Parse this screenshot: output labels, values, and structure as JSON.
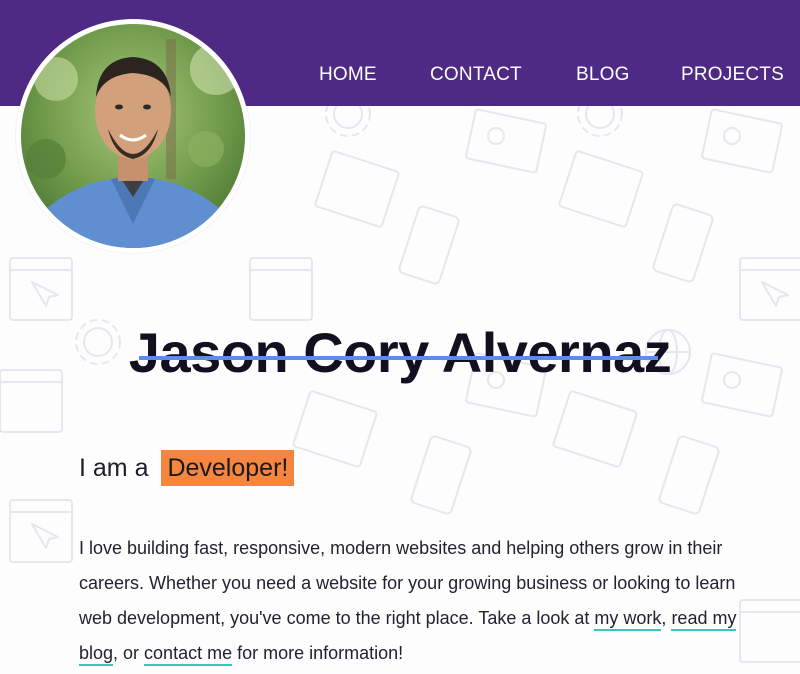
{
  "nav": {
    "items": [
      {
        "label": "HOME"
      },
      {
        "label": "CONTACT"
      },
      {
        "label": "BLOG"
      },
      {
        "label": "PROJECTS"
      }
    ]
  },
  "profile": {
    "name": "Jason Cory Alvernaz",
    "intro_prefix": "I am a",
    "role": "Developer!"
  },
  "intro": {
    "text_1": "I love building fast, responsive, modern websites and helping others grow in their careers. Whether you need a website for your growing business or looking to learn web development, you've come to the right place. Take a look at ",
    "link_work": "my work",
    "sep_1": ", ",
    "link_blog": "read my blog",
    "sep_2": ", or ",
    "link_contact": "contact me",
    "text_2": " for more information!"
  },
  "colors": {
    "header": "#4e2a84",
    "underline": "#5b8ee6",
    "badge": "#f5853f",
    "link_underline": "#39c5b9"
  },
  "icons": [
    "browser-window-icon",
    "cursor-icon",
    "gear-icon",
    "mobile-phone-icon",
    "magnifier-icon",
    "globe-icon"
  ]
}
